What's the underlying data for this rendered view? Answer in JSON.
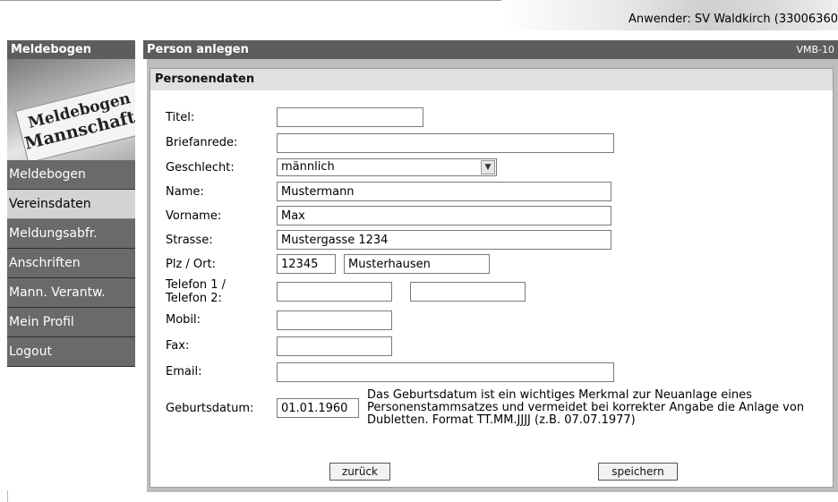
{
  "header": {
    "user_label": "Anwender: SV Waldkirch (33006360"
  },
  "sidebar": {
    "title": "Meldebogen",
    "banner_text_1": "Meldebogen",
    "banner_text_2": "Mannschaft:",
    "items": [
      {
        "label": "Meldebogen",
        "active": false
      },
      {
        "label": "Vereinsdaten",
        "active": true
      },
      {
        "label": "Meldungsabfr.",
        "active": false
      },
      {
        "label": "Anschriften",
        "active": false
      },
      {
        "label": "Mann. Verantw.",
        "active": false
      },
      {
        "label": "Mein Profil",
        "active": false
      },
      {
        "label": "Logout",
        "active": false
      }
    ]
  },
  "panel": {
    "title": "Person anlegen",
    "code": "VMB-10"
  },
  "form": {
    "section_title": "Personendaten",
    "labels": {
      "titel": "Titel:",
      "briefanrede": "Briefanrede:",
      "geschlecht": "Geschlecht:",
      "name": "Name:",
      "vorname": "Vorname:",
      "strasse": "Strasse:",
      "plz_ort": "Plz / Ort:",
      "telefon": "Telefon 1 / Telefon 2:",
      "mobil": "Mobil:",
      "fax": "Fax:",
      "email": "Email:",
      "geburtsdatum": "Geburtsdatum:"
    },
    "values": {
      "titel": "",
      "briefanrede": "",
      "geschlecht": "männlich",
      "name": "Mustermann",
      "vorname": "Max",
      "strasse": "Mustergasse 1234",
      "plz": "12345",
      "ort": "Musterhausen",
      "telefon1": "",
      "telefon2": "",
      "mobil": "",
      "fax": "",
      "email": "",
      "geburtsdatum": "01.01.1960"
    },
    "geburtsdatum_hint": "Das Geburtsdatum ist ein wichtiges Merkmal zur Neuanlage eines Personenstammsatzes und vermeidet bei korrekter Angabe die Anlage von Dubletten. Format TT.MM.JJJJ (z.B. 07.07.1977)"
  },
  "buttons": {
    "back": "zurück",
    "save": "speichern"
  },
  "icons": {
    "dropdown": "chevron-down-icon"
  },
  "colors": {
    "header_bg": "#5d5d5d",
    "nav_bg": "#6a6a6a",
    "nav_active_bg": "#d3d3d3",
    "frame_bg": "#bdbdbd"
  }
}
